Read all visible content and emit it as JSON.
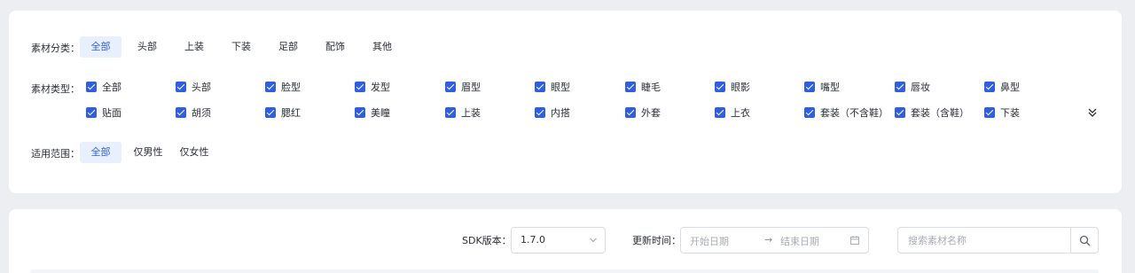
{
  "filters": {
    "category": {
      "label": "素材分类：",
      "options": [
        "全部",
        "头部",
        "上装",
        "下装",
        "足部",
        "配饰",
        "其他"
      ],
      "selected": "全部"
    },
    "type": {
      "label": "素材类型：",
      "row1": [
        "全部",
        "头部",
        "脸型",
        "发型",
        "眉型",
        "眼型",
        "睫毛",
        "眼影",
        "嘴型",
        "唇妆",
        "鼻型"
      ],
      "row2": [
        "贴面",
        "胡须",
        "腮红",
        "美瞳",
        "上装",
        "内搭",
        "外套",
        "上衣",
        "套装（不含鞋）",
        "套装（含鞋）",
        "下装"
      ],
      "all_checked": true,
      "expand_icon": "double-chevron-down-icon"
    },
    "scope": {
      "label": "适用范围：",
      "options": [
        "全部",
        "仅男性",
        "仅女性"
      ],
      "selected": "全部"
    }
  },
  "search": {
    "sdk_label": "SDK版本：",
    "sdk_value": "1.7.0",
    "update_label": "更新时间：",
    "start_placeholder": "开始日期",
    "end_placeholder": "结束日期",
    "arrow": "→",
    "keyword_placeholder": "搜索素材名称"
  },
  "colors": {
    "accent": "#2f5fe0",
    "chip_active_bg": "#e8effd",
    "page_bg": "#eceef2"
  }
}
